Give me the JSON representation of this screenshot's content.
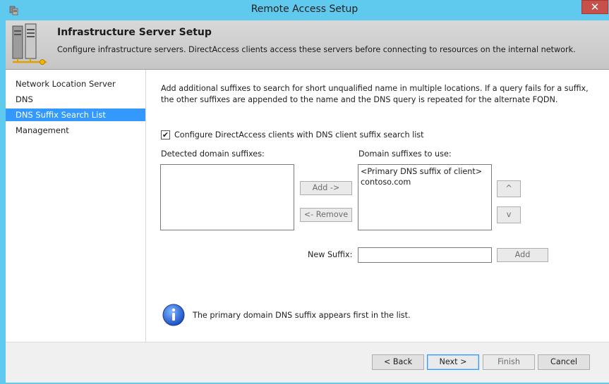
{
  "window": {
    "title": "Remote Access Setup",
    "close_label": "✕"
  },
  "header": {
    "title": "Infrastructure Server Setup",
    "subtitle": "Configure infrastructure servers. DirectAccess clients access these servers before connecting to resources on the internal network."
  },
  "nav": {
    "items": [
      {
        "label": "Network Location Server",
        "active": false
      },
      {
        "label": "DNS",
        "active": false
      },
      {
        "label": "DNS Suffix Search List",
        "active": true
      },
      {
        "label": "Management",
        "active": false
      }
    ]
  },
  "content": {
    "description": "Add additional suffixes to search for short unqualified name in multiple locations. If a query fails for a suffix, the other suffixes are appended to the name and the DNS query is repeated for the alternate FQDN.",
    "checkbox_label": "Configure DirectAccess clients with DNS client suffix search list",
    "checkbox_checked": true,
    "detected_label": "Detected domain suffixes:",
    "detected_items": [],
    "use_label": "Domain suffixes to use:",
    "use_items": [
      "<Primary DNS suffix of client>",
      "contoso.com"
    ],
    "add_button": "Add ->",
    "remove_button": "<- Remove",
    "up_button": "^",
    "down_button": "v",
    "new_suffix_label": "New Suffix:",
    "new_suffix_value": "",
    "add_suffix_button": "Add",
    "info_text": "The primary domain DNS suffix appears first in the list."
  },
  "footer": {
    "back": "< Back",
    "next": "Next >",
    "finish": "Finish",
    "cancel": "Cancel"
  },
  "colors": {
    "titlebar": "#60c9ee",
    "selection": "#3399ff",
    "close": "#c7504b"
  }
}
